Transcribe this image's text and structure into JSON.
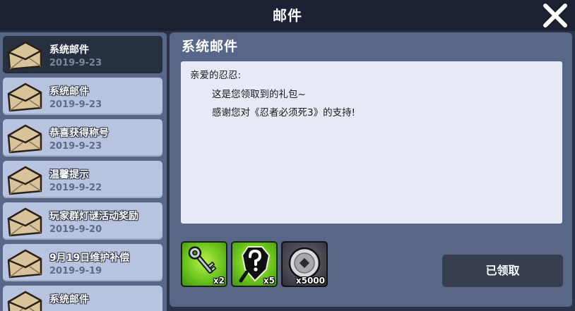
{
  "header": {
    "title": "邮件"
  },
  "mail_list": [
    {
      "subject": "系统邮件",
      "date": "2019-9-23",
      "selected": true
    },
    {
      "subject": "系统邮件",
      "date": "2019-9-23",
      "selected": false
    },
    {
      "subject": "恭喜获得称号",
      "date": "2019-9-23",
      "selected": false
    },
    {
      "subject": "温馨提示",
      "date": "2019-9-22",
      "selected": false
    },
    {
      "subject": "玩家群灯谜活动奖励",
      "date": "2019-9-20",
      "selected": false
    },
    {
      "subject": "9月19日维护补偿",
      "date": "2019-9-19",
      "selected": false
    },
    {
      "subject": "系统邮件",
      "date": "",
      "selected": false
    }
  ],
  "detail": {
    "title": "系统邮件",
    "body": {
      "greeting": "亲爱的忍忍:",
      "line1": "这是您领取到的礼包~",
      "line2": "感谢您对《忍者必须死3》的支持!"
    },
    "rewards": [
      {
        "icon": "key-icon",
        "count": "x2"
      },
      {
        "icon": "mystery-scroll-icon",
        "count": "x5"
      },
      {
        "icon": "coin-icon",
        "count": "x5000"
      }
    ],
    "claim_button": "已领取"
  },
  "colors": {
    "background": "#2b3246",
    "panel": "#586788",
    "selected_item": "#27303f",
    "list_item": "#b7c3df",
    "message_box": "#e6eaf4",
    "claim_button": "#363e50",
    "reward_green": "#6bc41d"
  }
}
